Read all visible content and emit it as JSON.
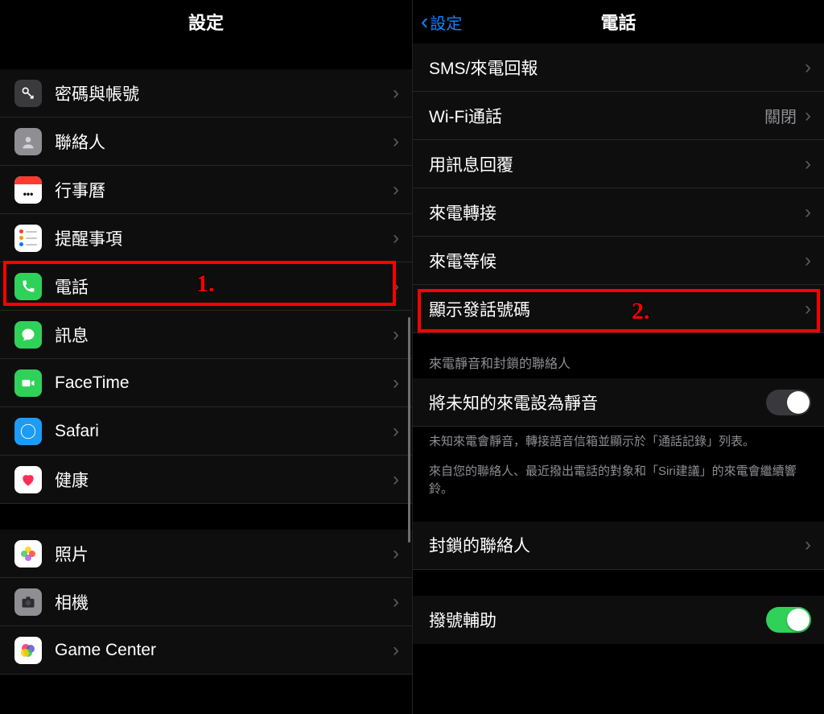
{
  "left": {
    "title": "設定",
    "items": [
      {
        "id": "passwords",
        "label": "密碼與帳號",
        "icon": "key-icon"
      },
      {
        "id": "contacts",
        "label": "聯絡人",
        "icon": "contacts-icon"
      },
      {
        "id": "calendar",
        "label": "行事曆",
        "icon": "calendar-icon"
      },
      {
        "id": "reminders",
        "label": "提醒事項",
        "icon": "reminders-icon"
      },
      {
        "id": "phone",
        "label": "電話",
        "icon": "phone-icon"
      },
      {
        "id": "messages",
        "label": "訊息",
        "icon": "messages-icon"
      },
      {
        "id": "facetime",
        "label": "FaceTime",
        "icon": "facetime-icon"
      },
      {
        "id": "safari",
        "label": "Safari",
        "icon": "safari-icon"
      },
      {
        "id": "health",
        "label": "健康",
        "icon": "health-icon"
      }
    ],
    "items2": [
      {
        "id": "photos",
        "label": "照片",
        "icon": "photos-icon"
      },
      {
        "id": "camera",
        "label": "相機",
        "icon": "camera-icon"
      },
      {
        "id": "gamecenter",
        "label": "Game Center",
        "icon": "gamecenter-icon"
      }
    ],
    "highlight_label": "1."
  },
  "right": {
    "back_label": "設定",
    "title": "電話",
    "rows_a": [
      {
        "id": "sms-callback",
        "label": "SMS/來電回報"
      },
      {
        "id": "wifi-calling",
        "label": "Wi-Fi通話",
        "value": "關閉"
      },
      {
        "id": "respond-text",
        "label": "用訊息回覆"
      },
      {
        "id": "call-forward",
        "label": "來電轉接"
      },
      {
        "id": "call-waiting",
        "label": "來電等候"
      },
      {
        "id": "show-caller-id",
        "label": "顯示發話號碼"
      }
    ],
    "section_header": "來電靜音和封鎖的聯絡人",
    "silence_row_label": "將未知的來電設為靜音",
    "silence_toggle": "off",
    "footer1": "未知來電會靜音，轉接語音信箱並顯示於「通話記錄」列表。",
    "footer2": "來自您的聯絡人、最近撥出電話的對象和「Siri建議」的來電會繼續響鈴。",
    "blocked_label": "封鎖的聯絡人",
    "dial_assist_label": "撥號輔助",
    "dial_assist_toggle": "on",
    "highlight_label": "2."
  }
}
